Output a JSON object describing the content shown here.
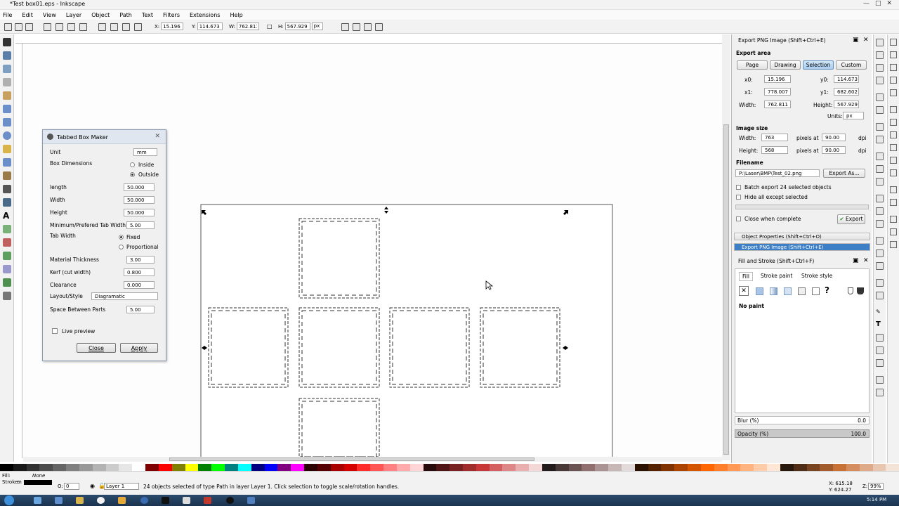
{
  "window": {
    "title": "*Test box01.eps - Inkscape"
  },
  "menu": [
    "File",
    "Edit",
    "View",
    "Layer",
    "Object",
    "Path",
    "Text",
    "Filters",
    "Extensions",
    "Help"
  ],
  "toolbar": {
    "x_label": "X:",
    "x_value": "15.196",
    "y_label": "Y:",
    "y_value": "114.673",
    "w_label": "W:",
    "w_value": "762.811",
    "h_label": "H:",
    "h_value": "567.929",
    "unit": "px"
  },
  "dialog": {
    "title": "Tabbed Box Maker",
    "unit_label": "Unit",
    "unit_value": "mm",
    "box_dimensions_label": "Box Dimensions",
    "inside_label": "Inside",
    "outside_label": "Outside",
    "length_label": "length",
    "length_value": "50.000",
    "width_label": "Width",
    "width_value": "50.000",
    "height_label": "Height",
    "height_value": "50.000",
    "tabwidth_label": "Minimum/Prefered Tab Width",
    "tabwidth_value": "5.00",
    "tab_width_label": "Tab Width",
    "fixed_label": "Fixed",
    "proportional_label": "Proportional",
    "material_label": "Material Thickness",
    "material_value": "3.00",
    "kerf_label": "Kerf (cut width)",
    "kerf_value": "0.800",
    "clearance_label": "Clearance",
    "clearance_value": "0.000",
    "layout_label": "Layout/Style",
    "layout_value": "Diagramatic",
    "space_label": "Space Between Parts",
    "space_value": "5.00",
    "live_preview_label": "Live preview",
    "close_label": "Close",
    "apply_label": "Apply"
  },
  "export_panel": {
    "title": "Export PNG Image (Shift+Ctrl+E)",
    "export_area_label": "Export area",
    "tabs": [
      "Page",
      "Drawing",
      "Selection",
      "Custom"
    ],
    "selected_tab": "Selection",
    "x0_label": "x0:",
    "x0_value": "15.196",
    "y0_label": "y0:",
    "y0_value": "114.673",
    "x1_label": "x1:",
    "x1_value": "778.007",
    "y1_label": "y1:",
    "y1_value": "682.602",
    "width_label": "Width:",
    "width_value": "762.811",
    "height_label": "Height:",
    "height_value": "567.929",
    "units_label": "Units:",
    "units_value": "px",
    "image_size_label": "Image size",
    "img_width_label": "Width:",
    "img_width_value": "763",
    "img_height_label": "Height:",
    "img_height_value": "568",
    "pixels_at_label": "pixels at",
    "dpi_value": "90.00",
    "dpi_label": "dpi",
    "filename_label": "Filename",
    "filename_value": "P:\\Laser\\BMP\\Test_02.png",
    "export_as_label": "Export As...",
    "batch_label": "Batch export 24 selected objects",
    "hide_label": "Hide all except selected",
    "close_when_label": "Close when complete",
    "export_label": "Export"
  },
  "docked": {
    "object_properties": "Object Properties (Shift+Ctrl+O)",
    "export_png": "Export PNG Image (Shift+Ctrl+E)"
  },
  "fill_stroke": {
    "title": "Fill and Stroke (Shift+Ctrl+F)",
    "tabs": [
      "Fill",
      "Stroke paint",
      "Stroke style"
    ],
    "no_paint": "No paint",
    "blur_label": "Blur (%)",
    "blur_value": "0.0",
    "opacity_label": "Opacity (%)",
    "opacity_value": "100.0"
  },
  "statusbar": {
    "fill_label": "Fill:",
    "stroke_label": "Stroke:",
    "fill_value": "None",
    "stroke_value": "m",
    "opacity_label": "O:",
    "opacity_value": "0",
    "layer": "Layer 1",
    "message": "24 objects selected of type Path in layer Layer 1. Click selection to toggle scale/rotation handles.",
    "x_coord": "X: 615.18",
    "y_coord": "Y: 624.27",
    "zoom_label": "Z:",
    "zoom_value": "99%"
  },
  "taskbar": {
    "time": "5:14 PM"
  },
  "colors": {
    "accent": "#3c7fc6",
    "selected_tab": "#a9cdef",
    "dialog_bg": "#f0f0f0"
  }
}
